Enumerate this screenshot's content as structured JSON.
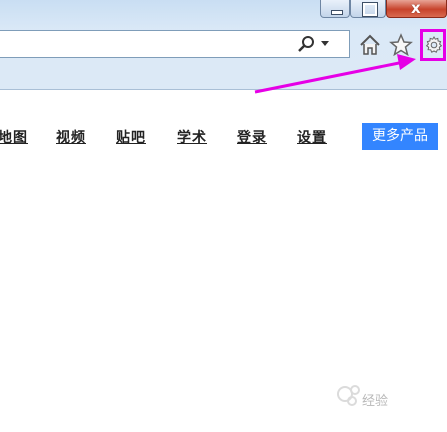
{
  "window": {
    "close_glyph": "x"
  },
  "toolbar": {
    "search_icon": "search-icon",
    "home_icon": "home-icon",
    "favorites_icon": "star-icon",
    "tools_icon": "gear-icon",
    "highlight_color": "#e600e6"
  },
  "page": {
    "nav": [
      "地图",
      "视频",
      "贴吧",
      "学术",
      "登录",
      "设置"
    ],
    "more_button": "更多产品",
    "accent": "#3385ff"
  },
  "watermark": {
    "text": "经验"
  }
}
